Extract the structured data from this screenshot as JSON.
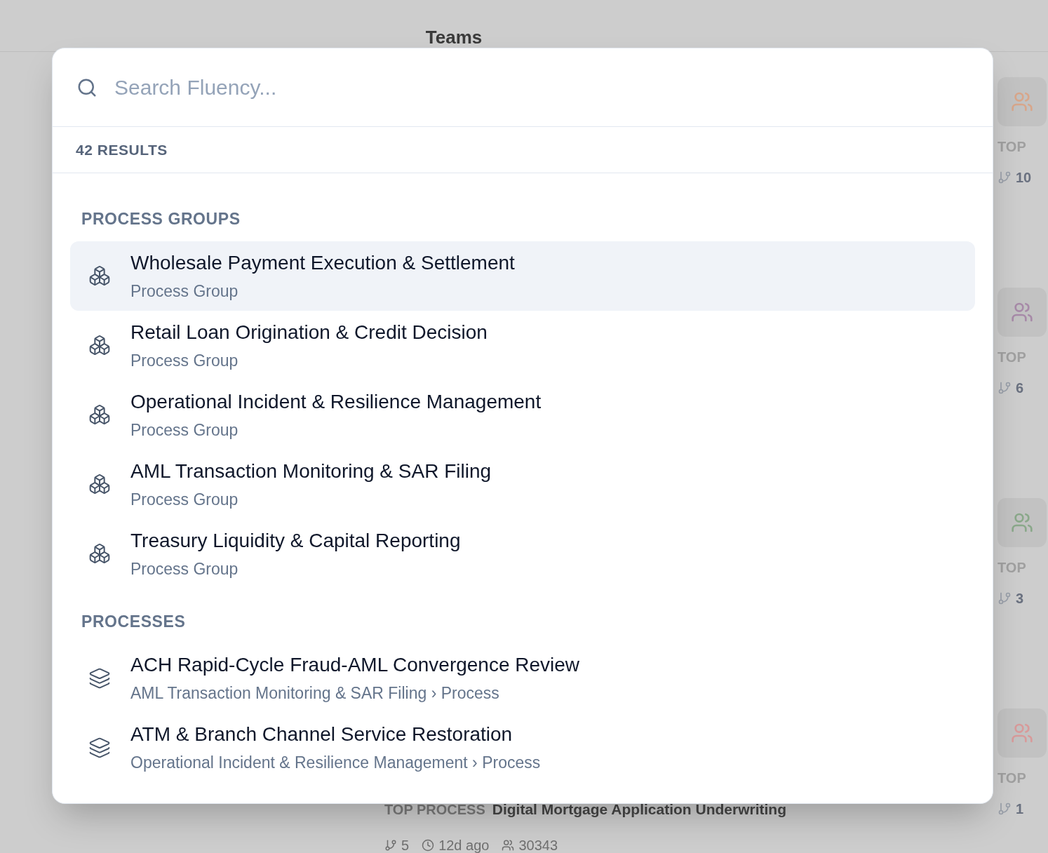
{
  "background": {
    "title": "Teams",
    "side_cards": [
      {
        "label": "TOP",
        "count": "10",
        "color": "#d8a68a"
      },
      {
        "label": "TOP",
        "count": "6",
        "color": "#a78aa8"
      },
      {
        "label": "TOP",
        "count": "3",
        "color": "#8aa88a"
      },
      {
        "label": "TOP",
        "count": "1",
        "color": "#d89a9a"
      }
    ],
    "bottom_card": {
      "label": "TOP PROCESS",
      "process": "Digital Mortgage Application Underwriting",
      "branches": "5",
      "updated": "12d ago",
      "members": "30343"
    }
  },
  "search": {
    "placeholder": "Search Fluency..."
  },
  "result_count": "42 RESULTS",
  "sections": [
    {
      "title": "PROCESS GROUPS",
      "items": [
        {
          "kind": "group",
          "title": "Wholesale Payment Execution & Settlement",
          "subtitle": "Process Group",
          "selected": true
        },
        {
          "kind": "group",
          "title": "Retail Loan Origination & Credit Decision",
          "subtitle": "Process Group",
          "selected": false
        },
        {
          "kind": "group",
          "title": "Operational Incident & Resilience Management",
          "subtitle": "Process Group",
          "selected": false
        },
        {
          "kind": "group",
          "title": "AML Transaction Monitoring & SAR Filing",
          "subtitle": "Process Group",
          "selected": false
        },
        {
          "kind": "group",
          "title": "Treasury Liquidity & Capital Reporting",
          "subtitle": "Process Group",
          "selected": false
        }
      ]
    },
    {
      "title": "PROCESSES",
      "items": [
        {
          "kind": "process",
          "title": "ACH Rapid-Cycle Fraud-AML Convergence Review",
          "subtitle": "AML Transaction Monitoring & SAR Filing › Process",
          "selected": false
        },
        {
          "kind": "process",
          "title": "ATM & Branch Channel Service Restoration",
          "subtitle": "Operational Incident & Resilience Management › Process",
          "selected": false
        }
      ]
    }
  ]
}
